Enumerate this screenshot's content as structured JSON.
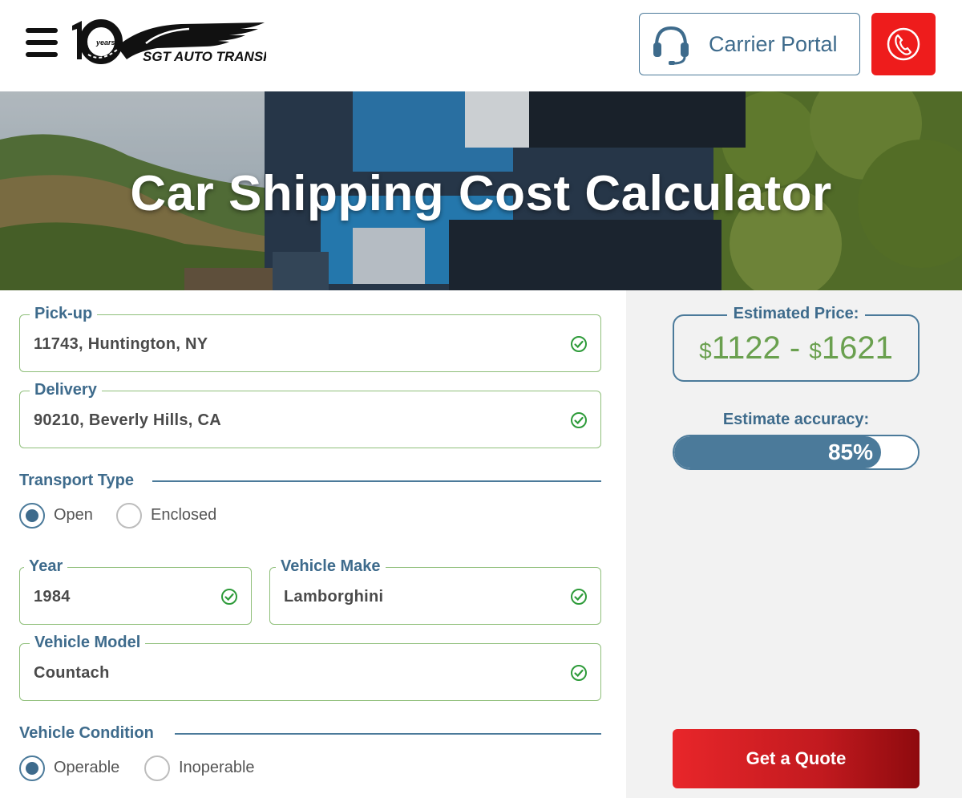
{
  "header": {
    "logo_text": "SGT AUTO TRANSPORT",
    "logo_badge_number": "10",
    "logo_badge_unit": "years",
    "carrier_portal_label": "Carrier Portal",
    "carrier_icon": "headset-icon",
    "phone_icon": "phone-icon",
    "menu_icon": "hamburger-menu-icon"
  },
  "hero": {
    "title": "Car Shipping Cost Calculator"
  },
  "form": {
    "pickup": {
      "label": "Pick-up",
      "value": "11743, Huntington, NY"
    },
    "delivery": {
      "label": "Delivery",
      "value": "90210, Beverly Hills, CA"
    },
    "transport_type": {
      "title": "Transport Type",
      "options": [
        {
          "label": "Open",
          "checked": true
        },
        {
          "label": "Enclosed",
          "checked": false
        }
      ]
    },
    "year": {
      "label": "Year",
      "value": "1984"
    },
    "make": {
      "label": "Vehicle Make",
      "value": "Lamborghini"
    },
    "model": {
      "label": "Vehicle Model",
      "value": "Countach"
    },
    "condition": {
      "title": "Vehicle Condition",
      "options": [
        {
          "label": "Operable",
          "checked": true
        },
        {
          "label": "Inoperable",
          "checked": false
        }
      ]
    }
  },
  "estimate": {
    "price_label": "Estimated Price:",
    "currency": "$",
    "price_low": "1122",
    "separator": " - ",
    "price_high": "1621",
    "accuracy_label": "Estimate accuracy:",
    "accuracy_value": 0.85,
    "accuracy_text": "85%",
    "quote_button": "Get a Quote"
  },
  "colors": {
    "brand_blue": "#3e6b8c",
    "accent_red": "#ee1c1c",
    "valid_green": "#6aa04f"
  }
}
